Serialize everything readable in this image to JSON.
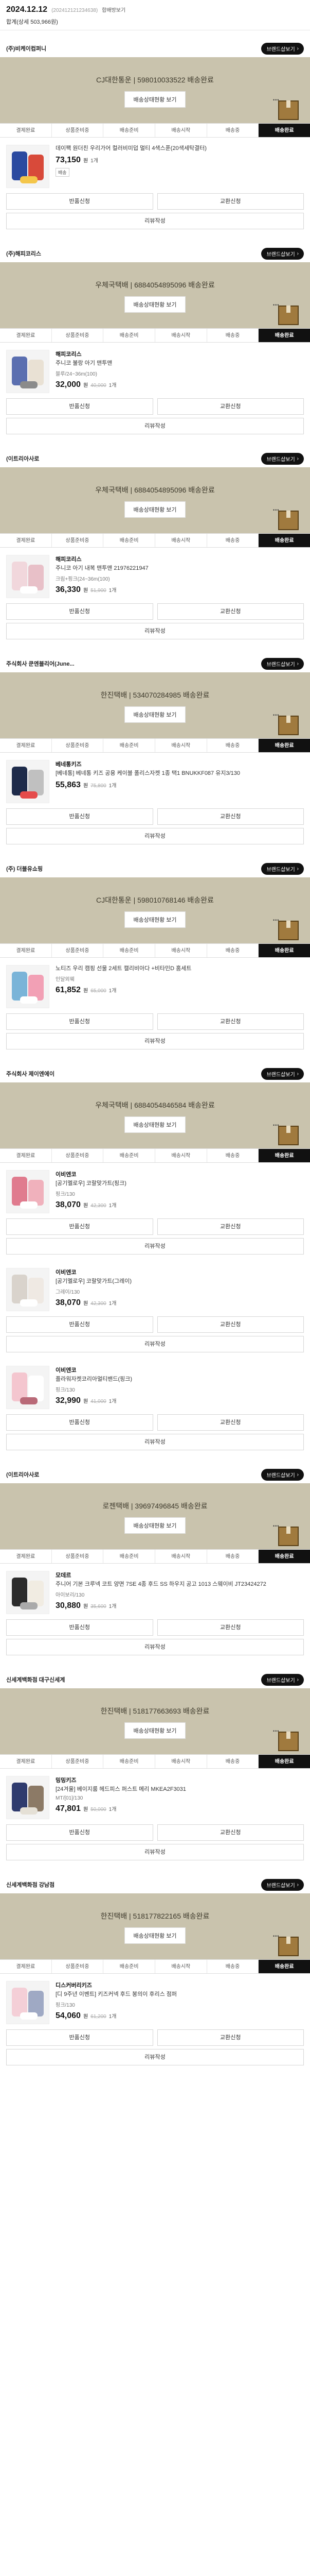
{
  "header": {
    "date": "2024.12.12",
    "order_code": "(202412121234638)",
    "tag": "합배방보기",
    "subtitle": "합계(상세 503,966원)"
  },
  "common": {
    "store_button": "브랜드샵보기",
    "track_button": "배송상태현황 보기",
    "steps": [
      "결제완료",
      "상품준비중",
      "배송준비",
      "배송시작",
      "배송중",
      "배송완료"
    ],
    "exchange": "반품신청",
    "return": "교환신청",
    "review": "리뷰작성",
    "won": "원",
    "qty": "1개"
  },
  "orders": [
    {
      "store": "(주)비케이컴퍼니",
      "carrier": "CJ대한통운 | 598010033522 배송완료",
      "items": [
        {
          "brand": "",
          "name": "데이팩 원더친 우리가어 컬러비미덥 멀티 4색스푼(20색세탁결터)",
          "option": "",
          "price": "73,150",
          "orig": "",
          "badge": "배송",
          "thumb": [
            "#2b4aa0",
            "#d84a3a",
            "#f4c64a"
          ]
        }
      ]
    },
    {
      "store": "(주)해피코리스",
      "carrier": "우체국택배 | 6884054895096 배송완료",
      "items": [
        {
          "brand": "해피코리스",
          "name": "주니코 불랑 아기 맨투맨",
          "option": "블루/24~36m(100)",
          "price": "32,000",
          "orig": "40,000",
          "badge": "",
          "thumb": [
            "#5b6fb0",
            "#e9e1d4",
            "#8b8b8b"
          ]
        }
      ]
    },
    {
      "store": "(이트리아사로",
      "carrier": "우체국택배 | 6884054895096 배송완료",
      "items": [
        {
          "brand": "해피코리스",
          "name": "주니코 아기 내복 맨투맨 21976221947",
          "option": "크림+핑크(24~36m(100)",
          "price": "36,330",
          "orig": "51,900",
          "badge": "",
          "thumb": [
            "#f1d7dc",
            "#e8c0c8",
            "#ffffff"
          ]
        }
      ]
    },
    {
      "store": "주식회사 쿤엔블리어(June...",
      "carrier": "한진택배 | 534070284985 배송완료",
      "items": [
        {
          "brand": "베네통키즈",
          "name": "[베네통] 베네통 키즈 공용 케이블 폴리스자켓 1종 택1 BNUKKF087 유지3/130",
          "option": "",
          "price": "55,863",
          "orig": "75,800",
          "badge": "",
          "thumb": [
            "#1e2b4a",
            "#c0c0c0",
            "#e54b4b"
          ]
        }
      ]
    },
    {
      "store": "(주) 더블유쇼핑",
      "carrier": "CJ대한통운 | 598010768146 배송완료",
      "items": [
        {
          "brand": "",
          "name": "노티즈 우리 캠핑 선물 2세트 캘리비아다 +비타민D 홈세트",
          "option": "인달외웨",
          "price": "61,852",
          "orig": "65,000",
          "badge": "",
          "thumb": [
            "#7ab4d8",
            "#f2a0b5",
            "#ffffff"
          ]
        }
      ]
    },
    {
      "store": "주식회사 제이엔에이",
      "carrier": "우체국택배 | 6884054846584 배송완료",
      "items": [
        {
          "brand": "이비엔코",
          "name": "[공기멜로우] 코랄맞가트(핑크)",
          "option": "핑크/130",
          "price": "38,070",
          "orig": "42,300",
          "badge": "",
          "thumb": [
            "#e07b8e",
            "#f0b1bc",
            "#ffffff"
          ]
        },
        {
          "brand": "이비엔코",
          "name": "[공기멜로우] 코랄맞가트(그레이)",
          "option": "그레이/130",
          "price": "38,070",
          "orig": "42,300",
          "badge": "",
          "thumb": [
            "#d9d3cc",
            "#efe9e3",
            "#ffffff"
          ]
        },
        {
          "brand": "이비엔코",
          "name": "플라워자켓코리아멀티밴드(핑크)",
          "option": "핑크/130",
          "price": "32,990",
          "orig": "41,000",
          "badge": "",
          "thumb": [
            "#f4c6cf",
            "#ffffff",
            "#b96a78"
          ]
        }
      ]
    },
    {
      "store": "(이트리아사로",
      "carrier": "로젠택배 | 39697496845 배송완료",
      "items": [
        {
          "brand": "모데르",
          "name": "주니어 기본 크루넥 코트 양면 7SE 4종 후드 SS 하우지 공고 1013 스웨이비 JT23424272",
          "option": "아이보리/130",
          "price": "30,880",
          "orig": "35,600",
          "badge": "",
          "thumb": [
            "#2c2c2c",
            "#f1ece2",
            "#aaa"
          ]
        }
      ]
    },
    {
      "store": "신세계백화점 대구신세계",
      "carrier": "한진택배 | 518177663693 배송완료",
      "items": [
        {
          "brand": "밍밍키즈",
          "name": "[24겨울] 베이지룸 헤드피스 퍼스트 메리 MKEA2F3031",
          "option": "MT/[01]/130",
          "price": "47,801",
          "orig": "50,000",
          "badge": "",
          "thumb": [
            "#2f3b6e",
            "#8c7a66",
            "#e5e0d6"
          ]
        }
      ]
    },
    {
      "store": "신세계백화점 강남점",
      "carrier": "한진택배 | 518177822165 배송완료",
      "items": [
        {
          "brand": "디스커버리키즈",
          "name": "[디 9주년 이벤트] 키즈커넥 후드 봉의이 후리스 점퍼",
          "option": "핑크/130",
          "price": "54,060",
          "orig": "61,200",
          "badge": "",
          "thumb": [
            "#f4cfd7",
            "#9fa9c4",
            "#ffffff"
          ]
        }
      ]
    }
  ]
}
